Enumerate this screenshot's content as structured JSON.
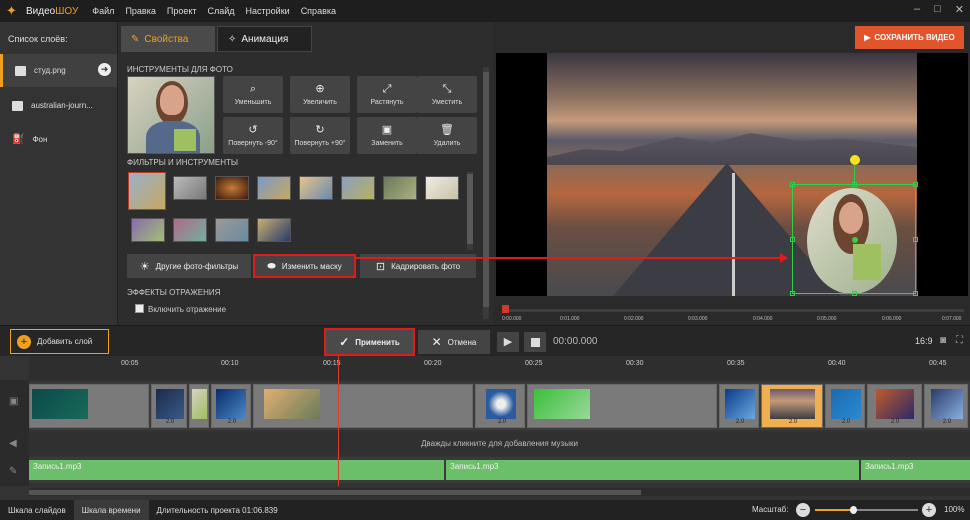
{
  "app": {
    "name_part1": "Видео",
    "name_part2": "ШОУ"
  },
  "menu": [
    "Файл",
    "Правка",
    "Проект",
    "Слайд",
    "Настройки",
    "Справка"
  ],
  "layers": {
    "title": "Список слоёв:",
    "items": [
      {
        "name": "студ.png",
        "icon": "image-icon",
        "selected": true
      },
      {
        "name": "australian-journ...",
        "icon": "image-icon",
        "selected": false
      },
      {
        "name": "Фон",
        "icon": "paint-bucket-icon",
        "selected": false
      }
    ]
  },
  "tabs": {
    "properties": "Свойства",
    "animation": "Анимация"
  },
  "photo_tools": {
    "title": "ИНСТРУМЕНТЫ ДЛЯ ФОТО",
    "buttons": [
      {
        "label": "Уменьшить",
        "icon": "zoom-out-icon"
      },
      {
        "label": "Увеличить",
        "icon": "zoom-in-icon"
      },
      {
        "label": "Растянуть",
        "icon": "stretch-icon"
      },
      {
        "label": "Уместить",
        "icon": "fit-icon"
      },
      {
        "label": "Повернуть -90°",
        "icon": "rotate-left-icon"
      },
      {
        "label": "Повернуть +90°",
        "icon": "rotate-right-icon"
      },
      {
        "label": "Заменить",
        "icon": "replace-icon"
      },
      {
        "label": "Удалить",
        "icon": "trash-icon"
      }
    ]
  },
  "filters": {
    "title": "ФИЛЬТРЫ И ИНСТРУМЕНТЫ",
    "other_filters": "Другие фото-фильтры",
    "change_mask": "Изменить маску",
    "crop_photo": "Кадрировать фото"
  },
  "reflection": {
    "title": "ЭФФЕКТЫ ОТРАЖЕНИЯ",
    "enable_label": "Включить отражение"
  },
  "save_video": "СОХРАНИТЬ ВИДЕО",
  "preview_ruler": [
    "0:00.000",
    "0:01.000",
    "0:02.000",
    "0:03.000",
    "0:04.000",
    "0:05.000",
    "0:06.000",
    "0:07.000"
  ],
  "actions": {
    "add_layer": "Добавить слой",
    "apply": "Применить",
    "cancel": "Отмена",
    "current_time": "00:00.000",
    "aspect": "16:9"
  },
  "timeline": {
    "ticks": [
      "00:05",
      "00:10",
      "00:15",
      "00:20",
      "00:25",
      "00:30",
      "00:35",
      "00:40",
      "00:45"
    ],
    "slide_durations": [
      "2.0",
      "2.0",
      "2.0",
      "2.0",
      "2.0",
      "2.0",
      "2.0",
      "2.0"
    ],
    "music_hint": "Дважды кликните для добавления музыки",
    "voice_segments": [
      "Запись1.mp3",
      "Запись1.mp3",
      "Запись1.mp3"
    ]
  },
  "status": {
    "storyboard": "Шкала слайдов",
    "timeline": "Шкала времени",
    "duration": "Длительность проекта 01:06.839",
    "zoom_label": "Масштаб:",
    "zoom_value": "100%",
    "zoom_level": 0.35
  },
  "colors": {
    "accent": "#f0a020",
    "save": "#e2542c",
    "highlight": "#e01b1b",
    "selection": "#2ed14a",
    "voice": "#6bbf6b"
  }
}
